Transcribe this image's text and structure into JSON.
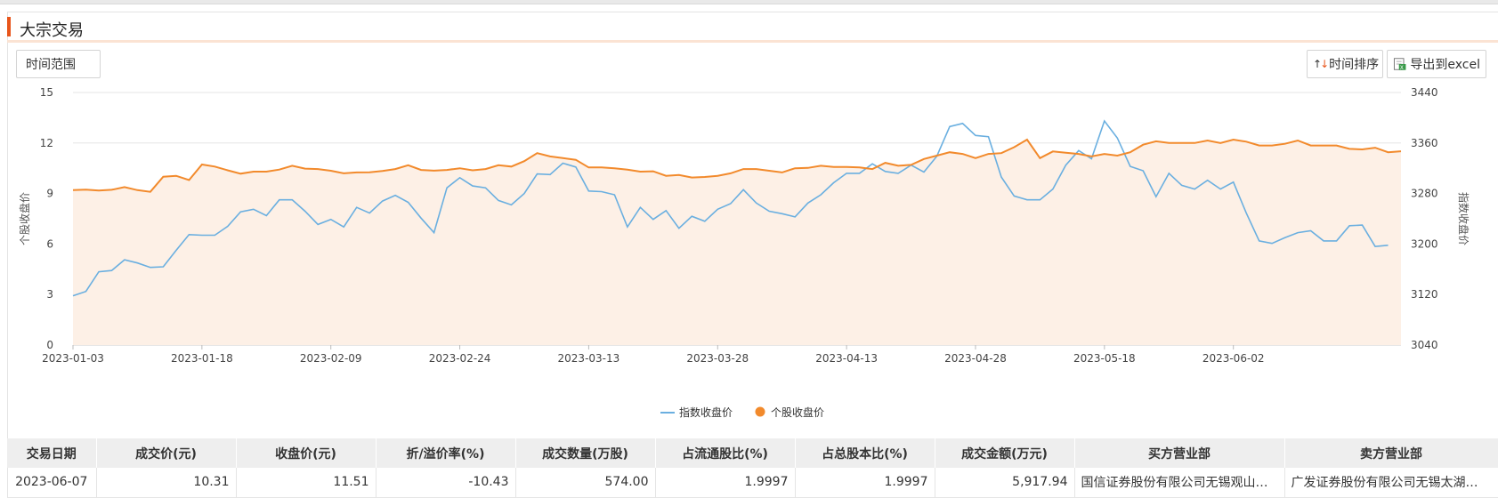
{
  "header": {
    "title": "大宗交易"
  },
  "toolbar": {
    "time_range_label": "时间范围",
    "sort_label": "时间排序",
    "export_label": "导出到excel"
  },
  "colors": {
    "accent": "#e8551b",
    "index_line": "#6aafe0",
    "stock_line": "#f28a2c",
    "area_fill": "#fdf0e6"
  },
  "chart_data": {
    "type": "line",
    "title": "",
    "left_axis_label": "个股收盘价",
    "right_axis_label": "指数收盘价",
    "left_ylim": [
      0,
      15
    ],
    "left_ticks": [
      "0",
      "3",
      "6",
      "9",
      "12",
      "15"
    ],
    "right_ylim": [
      3040,
      3440
    ],
    "right_ticks": [
      "3040",
      "3120",
      "3200",
      "3280",
      "3360",
      "3440"
    ],
    "x_ticks": [
      "2023-01-03",
      "2023-01-18",
      "2023-02-09",
      "2023-02-24",
      "2023-03-13",
      "2023-03-28",
      "2023-04-13",
      "2023-04-28",
      "2023-05-18",
      "2023-06-02"
    ],
    "x_tick_indices": [
      0,
      10,
      20,
      30,
      40,
      50,
      60,
      70,
      80,
      90
    ],
    "grid": true,
    "legend_position": "bottom-center",
    "series": [
      {
        "name": "指数收盘价",
        "axis": "right",
        "color": "#6aafe0",
        "values": [
          3118,
          3125,
          3156,
          3158,
          3175,
          3170,
          3163,
          3164,
          3190,
          3215,
          3214,
          3214,
          3228,
          3251,
          3255,
          3245,
          3270,
          3270,
          3252,
          3231,
          3239,
          3227,
          3258,
          3249,
          3268,
          3277,
          3266,
          3241,
          3218,
          3289,
          3305,
          3292,
          3289,
          3269,
          3262,
          3280,
          3311,
          3310,
          3328,
          3322,
          3284,
          3283,
          3278,
          3227,
          3258,
          3239,
          3253,
          3225,
          3244,
          3236,
          3255,
          3264,
          3286,
          3265,
          3252,
          3248,
          3243,
          3265,
          3278,
          3297,
          3312,
          3312,
          3327,
          3315,
          3312,
          3325,
          3314,
          3339,
          3386,
          3391,
          3372,
          3370,
          3306,
          3276,
          3270,
          3270,
          3287,
          3325,
          3348,
          3335,
          3395,
          3368,
          3323,
          3316,
          3275,
          3312,
          3293,
          3287,
          3301,
          3287,
          3298,
          3249,
          3205,
          3201,
          3210,
          3218,
          3221,
          3205,
          3205,
          3229,
          3230,
          3196,
          3198
        ]
      },
      {
        "name": "个股收盘价",
        "axis": "left",
        "color": "#f28a2c",
        "values": [
          9.2,
          9.23,
          9.18,
          9.22,
          9.38,
          9.2,
          9.1,
          10.0,
          10.05,
          9.8,
          10.72,
          10.6,
          10.38,
          10.18,
          10.3,
          10.3,
          10.42,
          10.65,
          10.48,
          10.45,
          10.35,
          10.2,
          10.25,
          10.26,
          10.34,
          10.45,
          10.68,
          10.4,
          10.36,
          10.4,
          10.5,
          10.38,
          10.45,
          10.68,
          10.6,
          10.92,
          11.4,
          11.2,
          11.1,
          11.0,
          10.55,
          10.55,
          10.5,
          10.42,
          10.3,
          10.32,
          10.05,
          10.1,
          9.95,
          9.98,
          10.05,
          10.2,
          10.45,
          10.45,
          10.35,
          10.25,
          10.5,
          10.52,
          10.65,
          10.58,
          10.58,
          10.55,
          10.45,
          10.82,
          10.65,
          10.7,
          11.05,
          11.25,
          11.45,
          11.35,
          11.1,
          11.35,
          11.4,
          11.75,
          12.2,
          11.1,
          11.5,
          11.42,
          11.35,
          11.2,
          11.35,
          11.25,
          11.45,
          11.9,
          12.1,
          12.0,
          12.0,
          12.0,
          12.15,
          12.0,
          12.2,
          12.08,
          11.85,
          11.85,
          11.95,
          12.15,
          11.85,
          11.85,
          11.85,
          11.65,
          11.62,
          11.72,
          11.45,
          11.51
        ]
      }
    ]
  },
  "table": {
    "headers": [
      "交易日期",
      "成交价(元)",
      "收盘价(元)",
      "折/溢价率(%)",
      "成交数量(万股)",
      "占流通股比(%)",
      "占总股本比(%)",
      "成交金额(万元)",
      "买方营业部",
      "卖方营业部"
    ],
    "rows": [
      [
        "2023-06-07",
        "10.31",
        "11.51",
        "-10.43",
        "574.00",
        "1.9997",
        "1.9997",
        "5,917.94",
        "国信证券股份有限公司无锡观山路…",
        "广发证券股份有限公司无锡太湖…"
      ]
    ]
  }
}
